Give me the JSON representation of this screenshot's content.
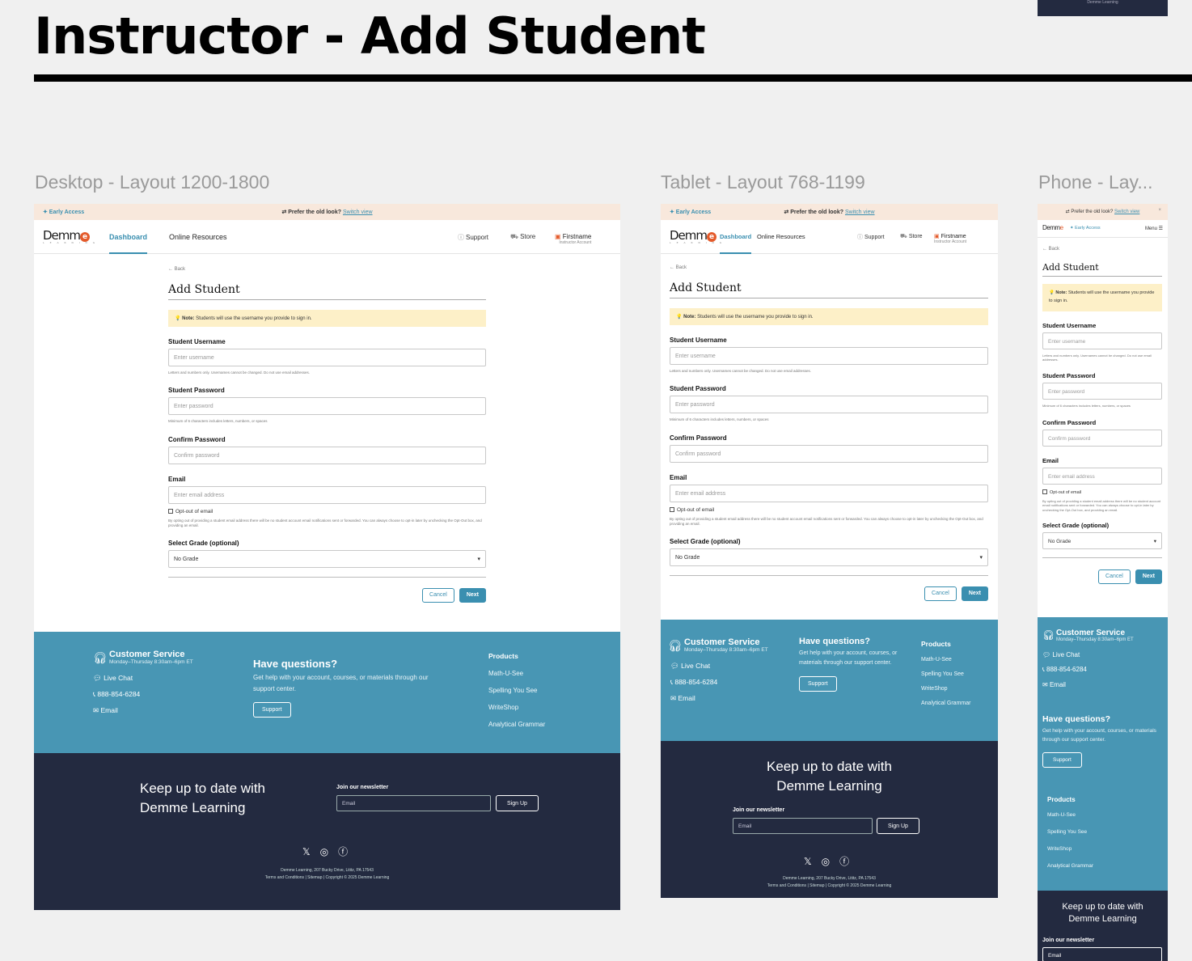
{
  "board": {
    "title": "Instructor - Add Student"
  },
  "labels": {
    "desktop": "Desktop - Layout 1200-1800",
    "tablet": "Tablet - Layout 768-1199",
    "phone": "Phone - Lay..."
  },
  "topbar": {
    "early_access": "✦ Early Access",
    "prefer": "⇄ Prefer the old look?",
    "switch": "Switch view",
    "close": "×"
  },
  "logo": {
    "text": "Demm",
    "mark": "e",
    "sub": "L E A R N I N G"
  },
  "nav": {
    "dashboard": "Dashboard",
    "online": "Online Resources",
    "support": "Support",
    "store": "Store",
    "user": "Firstname",
    "account": "Instructor Account",
    "menu": "Menu ☰"
  },
  "form": {
    "back": "← Back",
    "title": "Add Student",
    "note_b": "Note:",
    "note": "Students will use the username you provide to sign in.",
    "username_label": "Student Username",
    "username_ph": "Enter username",
    "username_help": "Letters and numbers only. Usernames cannot be changed. Do not use email addresses.",
    "password_label": "Student Password",
    "password_ph": "Enter password",
    "password_help": "Minimum of 6 characters includes letters, numbers, or spaces",
    "confirm_label": "Confirm Password",
    "confirm_ph": "Confirm password",
    "email_label": "Email",
    "email_ph": "Enter email address",
    "optout": "Opt-out of email",
    "optout_help": "By opting out of providing a student email address there will be no student account email notifications sent or forwarded. You can always choose to opt-in later by unchecking the Opt-Out box, and providing an email.",
    "grade_label": "Select Grade (optional)",
    "grade_value": "No Grade",
    "cancel": "Cancel",
    "next": "Next"
  },
  "footer": {
    "cs_title": "Customer Service",
    "cs_hours": "Monday–Thursday 8:30am–6pm ET",
    "live_chat": "Live Chat",
    "phone": "888-854-6284",
    "email": "Email",
    "hq_title": "Have questions?",
    "hq_text": "Get help with your account, courses, or materials through our support center.",
    "support_btn": "Support",
    "products": "Products",
    "p1": "Math-U-See",
    "p2": "Spelling You See",
    "p3": "WriteShop",
    "p4": "Analytical Grammar",
    "nl_title1": "Keep up to date with",
    "nl_title2": "Demme Learning",
    "nl_label": "Join our newsletter",
    "nl_ph": "Email",
    "nl_btn": "Sign Up",
    "address": "Demme Learning, 207 Bucky Drive, Lititz, PA 17543",
    "legal": "Terms and Conditions | Sitemap | Copyright © 2025 Demme Learning",
    "top_logo_text": "Demme Learning"
  }
}
